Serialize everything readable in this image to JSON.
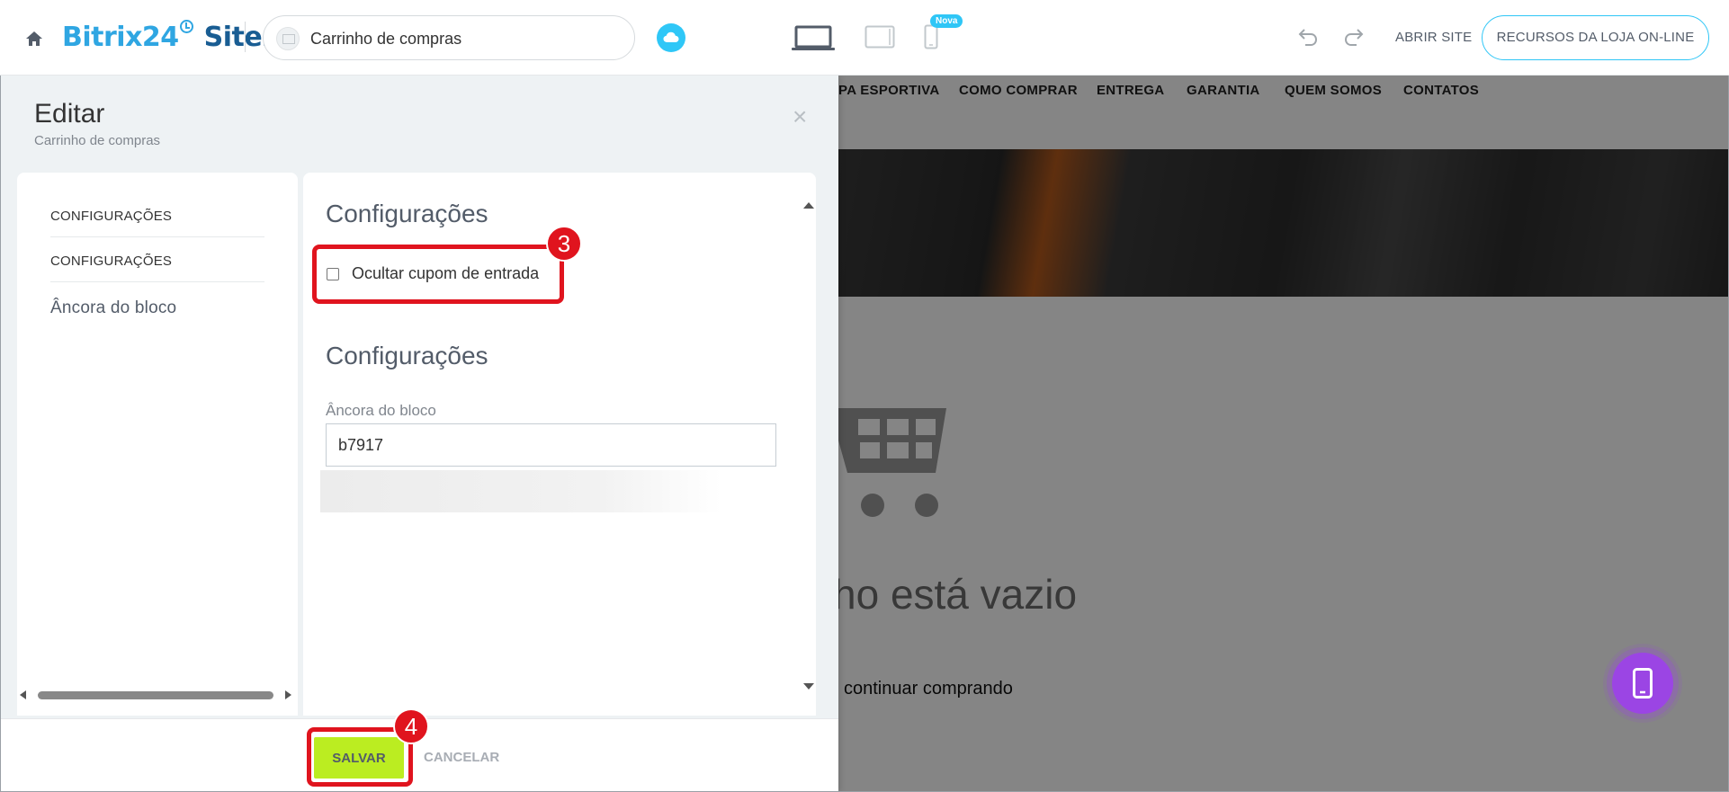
{
  "topbar": {
    "logo_main": "Bitrix24",
    "logo_sites": "Sites",
    "page_name": "Carrinho de compras",
    "nova_badge": "Nova",
    "abrir_site": "ABRIR SITE",
    "recursos": "RECURSOS DA LOJA ON-LINE"
  },
  "site_preview": {
    "nav_items": [
      "PA ESPORTIVA",
      "COMO COMPRAR",
      "ENTREGA",
      "GARANTIA",
      "QUEM SOMOS",
      "CONTATOS"
    ],
    "empty_text": "ho está vazio",
    "continue_text": "continuar comprando"
  },
  "panel": {
    "title": "Editar",
    "subtitle": "Carrinho de compras",
    "close": "×",
    "nav": [
      "Configurações",
      "Configurações",
      "Âncora do bloco"
    ],
    "section1_title": "Configurações",
    "checkbox_label": "Ocultar cupom de entrada",
    "checkbox_checked": false,
    "section2_title": "Configurações",
    "field_label": "Âncora do bloco",
    "field_value": "b7917"
  },
  "footer": {
    "save": "SALVAR",
    "cancel": "CANCELAR"
  },
  "annotations": {
    "marker_checkbox": "3",
    "marker_save": "4"
  },
  "colors": {
    "accent_blue": "#2fa6e2",
    "save_green": "#bbed21",
    "highlight_red": "#e0141e",
    "fab_purple": "#9b45e4"
  },
  "icons": [
    "home-icon",
    "cloud-icon",
    "laptop-icon",
    "tablet-icon",
    "phone-icon",
    "undo-icon",
    "redo-icon",
    "cart-icon",
    "mobile-icon",
    "close-icon"
  ]
}
